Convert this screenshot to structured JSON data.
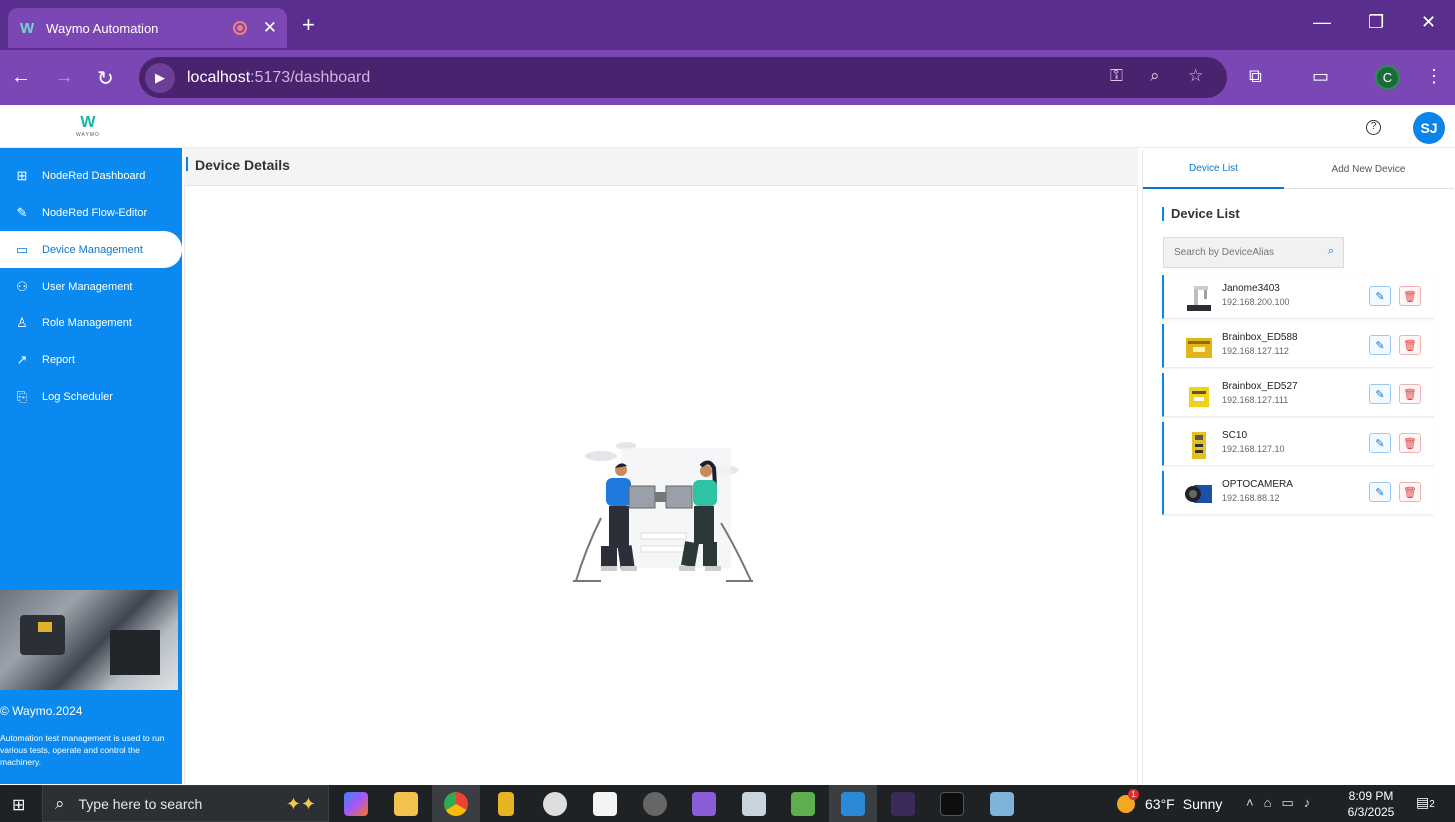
{
  "browser": {
    "tab_title": "Waymo Automation",
    "tab_logo": "W",
    "url_host": "localhost",
    "url_path": ":5173/dashboard",
    "profile_initial": "C"
  },
  "header": {
    "logo_text": "W",
    "logo_sub": "WAYMO",
    "help_glyph": "?",
    "user_initials": "SJ"
  },
  "sidebar": {
    "items": [
      {
        "label": "NodeRed Dashboard",
        "icon": "sitemap-icon"
      },
      {
        "label": "NodeRed Flow-Editor",
        "icon": "flow-editor-icon"
      },
      {
        "label": "Device Management",
        "icon": "monitor-icon"
      },
      {
        "label": "User Management",
        "icon": "user-management-icon"
      },
      {
        "label": "Role Management",
        "icon": "role-icon"
      },
      {
        "label": "Report",
        "icon": "chart-icon"
      },
      {
        "label": "Log Scheduler",
        "icon": "log-icon"
      }
    ],
    "active_index": 2,
    "copyright": "© Waymo.2024",
    "description": "Automation test management is used to run various tests, operate and control the machinery."
  },
  "main": {
    "title": "Device Details"
  },
  "right_panel": {
    "tabs": [
      {
        "label": "Device List",
        "active": true
      },
      {
        "label": "Add New Device",
        "active": false
      }
    ],
    "title": "Device List",
    "search_placeholder": "Search by DeviceAlias",
    "devices": [
      {
        "name": "Janome3403",
        "ip": "192.168.200.100",
        "icon": "robot-arm-icon"
      },
      {
        "name": "Brainbox_ED588",
        "ip": "192.168.127.112",
        "icon": "io-module-icon"
      },
      {
        "name": "Brainbox_ED527",
        "ip": "192.168.127.111",
        "icon": "io-module-small-icon"
      },
      {
        "name": "SC10",
        "ip": "192.168.127.10",
        "icon": "controller-icon"
      },
      {
        "name": "OPTOCAMERA",
        "ip": "192.168.88.12",
        "icon": "camera-icon"
      }
    ]
  },
  "taskbar": {
    "search_placeholder": "Type here to search",
    "weather_temp": "63°F",
    "weather_text": "Sunny",
    "weather_badge": "1",
    "time": "8:09 PM",
    "date": "6/3/2025",
    "notification_count": "2"
  },
  "colors": {
    "browser_frame": "#5a2e8f",
    "sidebar": "#0a8af0",
    "accent": "#0a84e8",
    "delete": "#e23d3d"
  }
}
